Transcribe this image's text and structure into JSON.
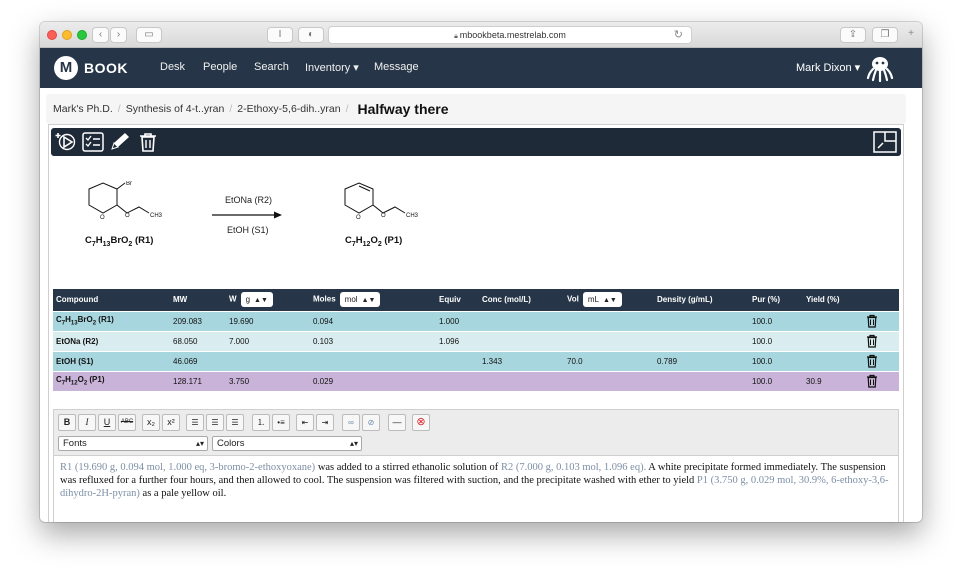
{
  "browser": {
    "url": "mbookbeta.mestrelab.com",
    "reader_label": "I"
  },
  "navbar": {
    "logo_letter": "M",
    "brand": "BOOK",
    "items": [
      "Desk",
      "People",
      "Search",
      "Inventory ▾",
      "Message"
    ],
    "user": "Mark Dixon ▾"
  },
  "breadcrumb": {
    "items": [
      "Mark's Ph.D.",
      "Synthesis of 4-t..yran",
      "2-Ethoxy-5,6-dih..yran"
    ],
    "current": "Halfway there"
  },
  "scheme": {
    "reactant_label": "C7H13BrO2 (R1)",
    "product_label": "C7H12O2 (P1)",
    "reagent_above": "EtONa (R2)",
    "reagent_below": "EtOH (S1)",
    "atom_br": "Br",
    "atom_o": "O",
    "atom_ch3": "CH3"
  },
  "table": {
    "headers": {
      "compound": "Compound",
      "mw": "MW",
      "w": "W",
      "w_unit": "g",
      "moles": "Moles",
      "moles_unit": "mol",
      "equiv": "Equiv",
      "conc": "Conc (mol/L)",
      "vol": "Vol",
      "vol_unit": "mL",
      "density": "Density (g/mL)",
      "pur": "Pur (%)",
      "yield": "Yield (%)"
    },
    "rows": [
      {
        "compound": "C7H13BrO2 (R1)",
        "mw": "209.083",
        "w": "19.690",
        "moles": "0.094",
        "equiv": "1.000",
        "conc": "",
        "vol": "",
        "density": "",
        "pur": "100.0",
        "yield": ""
      },
      {
        "compound": "EtONa (R2)",
        "mw": "68.050",
        "w": "7.000",
        "moles": "0.103",
        "equiv": "1.096",
        "conc": "",
        "vol": "",
        "density": "",
        "pur": "100.0",
        "yield": ""
      },
      {
        "compound": "EtOH (S1)",
        "mw": "46.069",
        "w": "",
        "moles": "",
        "equiv": "",
        "conc": "1.343",
        "vol": "70.0",
        "density": "0.789",
        "pur": "100.0",
        "yield": ""
      },
      {
        "compound": "C7H12O2 (P1)",
        "mw": "128.171",
        "w": "3.750",
        "moles": "0.029",
        "equiv": "",
        "conc": "",
        "vol": "",
        "density": "",
        "pur": "100.0",
        "yield": "30.9"
      }
    ]
  },
  "editor": {
    "buttons": [
      "B",
      "I",
      "U",
      "ABC",
      "x₂",
      "x²"
    ],
    "fonts_label": "Fonts",
    "colors_label": "Colors",
    "text": {
      "p1_ref": "R1",
      "p1_info": "(19.690 g, 0.094 mol, 1.000 eq, 3-bromo-2-ethoxyoxane)",
      "p1_mid": " was added to a stirred ethanolic solution of ",
      "p2_ref": "R2",
      "p2_info": "(7.000 g, 0.103 mol, 1.096 eq).",
      "p2_rest": "  A white precipitate formed immediately.  The suspension was refluxed for a further four hours, and then allowed to cool.  The suspension was filtered with suction, and the precipitate washed with ether to yield ",
      "p3_ref": "P1",
      "p3_info": "(3.750 g, 0.029 mol, 30.9%, 6-ethoxy-3,6-dihydro-2H-pyran)",
      "p3_rest": " as a pale yellow oil."
    }
  },
  "colors": {
    "navbar": "#263648",
    "row_reactant": "#a8d6de",
    "row_reagent": "#d9ecef",
    "row_product": "#c9b3d8",
    "reference_text": "#7d8fa5"
  }
}
